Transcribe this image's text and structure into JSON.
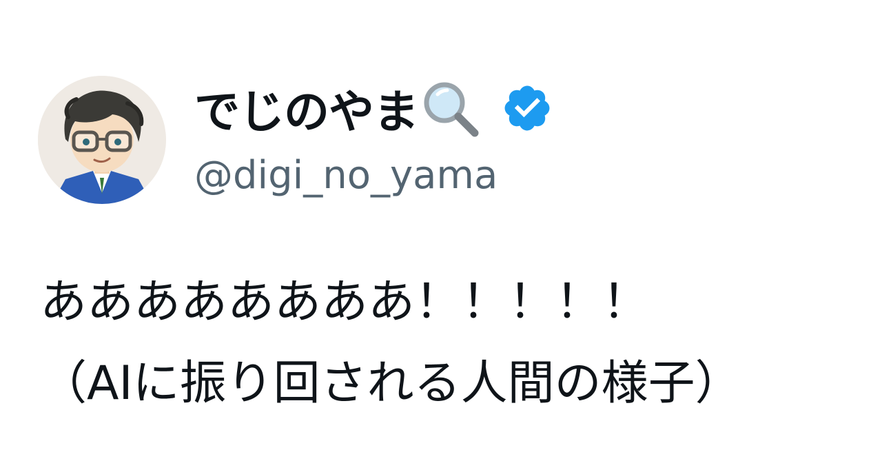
{
  "author": {
    "display_name": "でじのやま",
    "name_emoji": "magnifying-glass-icon",
    "verified": true,
    "handle": "@digi_no_yama",
    "avatar": "illustrated-avatar-man-with-glasses"
  },
  "tweet": {
    "lines": [
      "ああああああああ！！！！！",
      "（AIに振り回される人間の様子）"
    ]
  },
  "colors": {
    "text": "#0f1419",
    "handle": "#536471",
    "verified_badge": "#1d9bf0",
    "background": "#ffffff"
  }
}
